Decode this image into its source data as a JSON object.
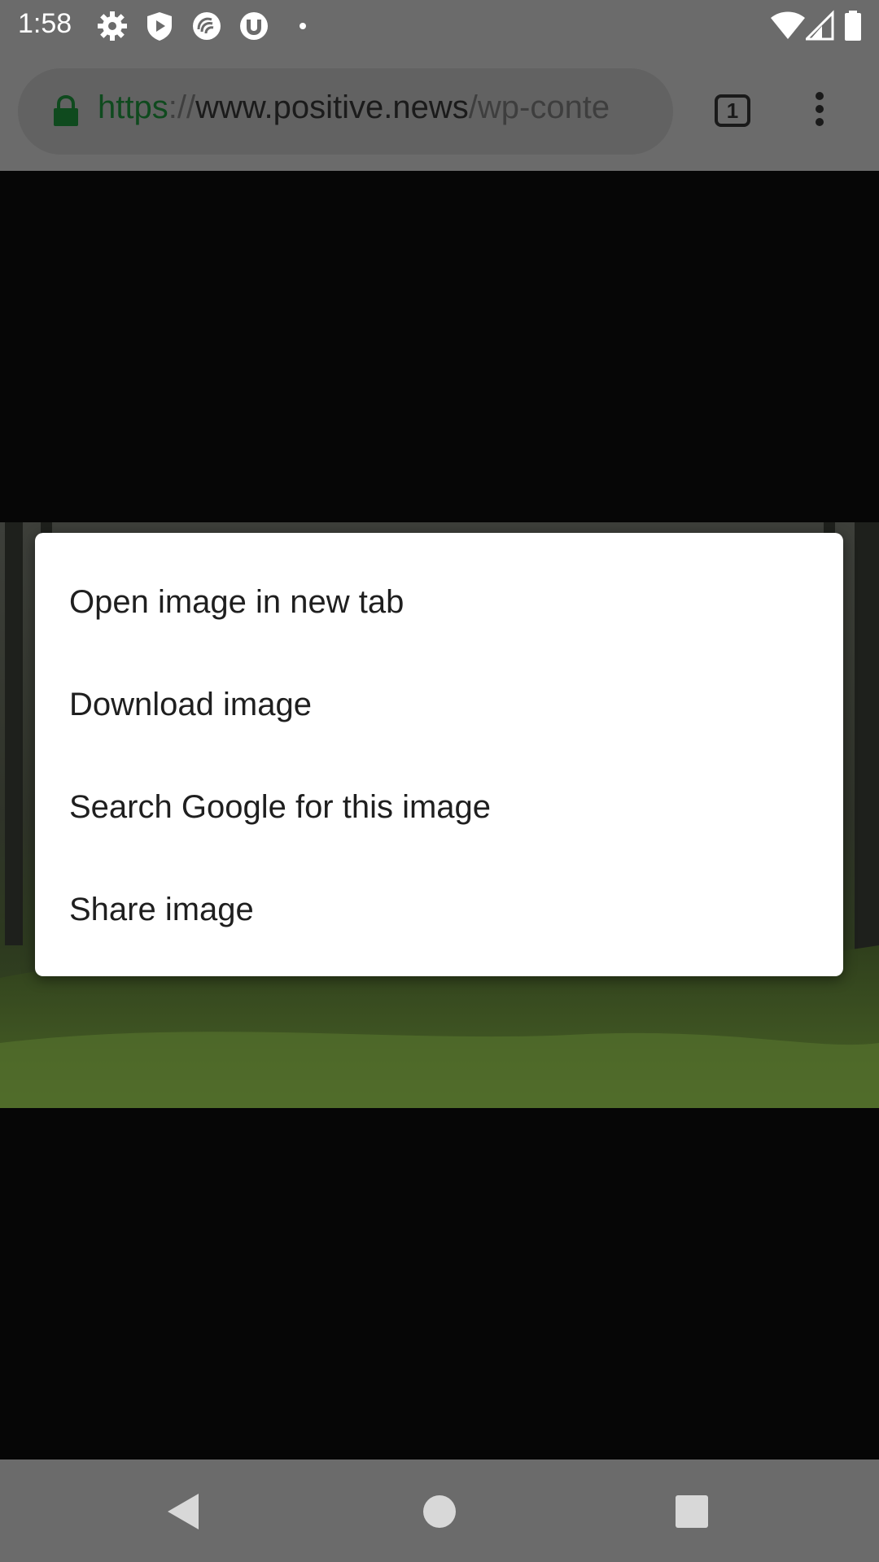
{
  "status_bar": {
    "time": "1:58",
    "left_icons": [
      "settings-icon",
      "shield-play-icon",
      "app-swirl-icon",
      "torrent-icon",
      "dot-icon"
    ],
    "right_icons": [
      "wifi-icon",
      "signal-icon",
      "battery-icon"
    ]
  },
  "toolbar": {
    "url_scheme": "https",
    "url_sep": "://",
    "url_host": "www.positive.news",
    "url_path": "/wp-conte",
    "tab_count": "1",
    "lock_color": "#0f4a1e"
  },
  "context_menu": {
    "items": [
      {
        "label": "Open image in new tab"
      },
      {
        "label": "Download image"
      },
      {
        "label": "Search Google for this image"
      },
      {
        "label": "Share image"
      }
    ]
  },
  "nav_bar": {
    "buttons": [
      "back-icon",
      "home-icon",
      "recents-icon"
    ]
  }
}
